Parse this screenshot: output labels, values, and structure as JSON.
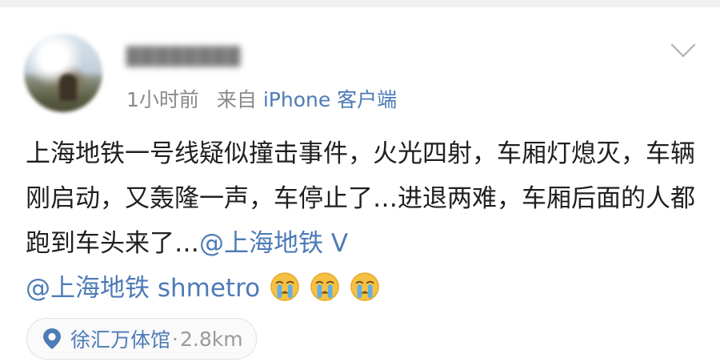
{
  "post": {
    "meta": {
      "time": "1小时前",
      "source_prefix": "来自",
      "source_device": "iPhone 客户端"
    },
    "content": {
      "text": "上海地铁一号线疑似撞击事件，火光四射，车厢灯熄灭，车辆刚启动，又轰隆一声，车停止了…进退两难，车厢后面的人都跑到车头来了…",
      "mention_1": "@上海地铁",
      "link_after_mention_1": "V",
      "mention_2": "@上海地铁 shmetro"
    },
    "emojis": [
      "crying-face-emoji",
      "crying-face-emoji",
      "crying-face-emoji"
    ],
    "location": {
      "place": "徐汇万体馆",
      "separator": "·",
      "distance": "2.8km"
    }
  },
  "colors": {
    "link_blue": "#4d7bb6",
    "meta_gray": "#8a8a8a",
    "text_dark": "#202020",
    "emoji_yellow": "#f6c142",
    "tear_blue": "#5fb0e8"
  }
}
